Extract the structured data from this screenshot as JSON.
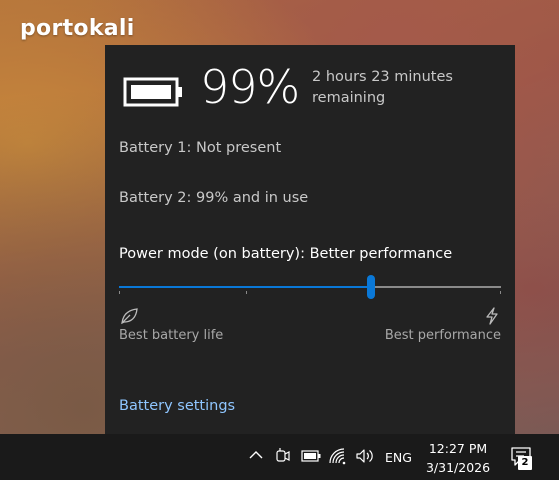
{
  "watermark": "portokali",
  "battery_flyout": {
    "percent": "99%",
    "remaining": "2 hours 23 minutes remaining",
    "battery_1": "Battery 1: Not present",
    "battery_2": "Battery 2: 99% and in use",
    "power_mode": "Power mode (on battery): Better performance",
    "slider": {
      "value_fraction": 0.66,
      "stops": 4
    },
    "left_label": "Best battery life",
    "right_label": "Best performance",
    "settings_link": "Battery settings",
    "icons": {
      "battery": "battery-icon",
      "left": "leaf-icon",
      "right": "lightning-icon"
    }
  },
  "taskbar": {
    "icons": [
      "chevron-up-icon",
      "meet-now-icon",
      "battery-icon",
      "wifi-icon",
      "volume-icon"
    ],
    "language": "ENG",
    "time": "12:27 PM",
    "date": "3/31/2026",
    "notification_count": "2"
  },
  "colors": {
    "accent": "#0a78d7",
    "link": "#8fc6ff",
    "flyout_bg": "#222222"
  }
}
